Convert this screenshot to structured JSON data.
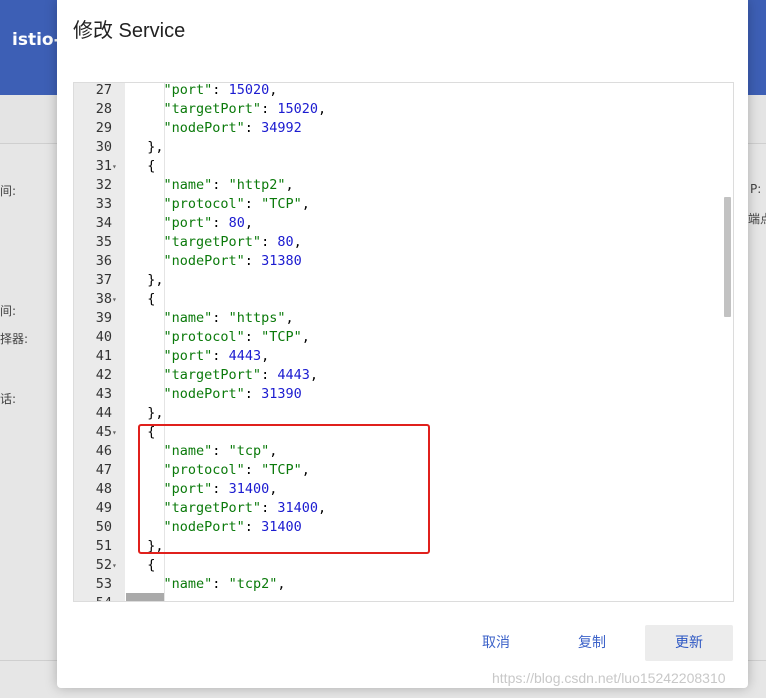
{
  "background": {
    "app_title": "istio-i",
    "labels_left": [
      "间:",
      "间:",
      "择器:",
      "话:"
    ],
    "labels_right": [
      "P:",
      "端点"
    ]
  },
  "dialog": {
    "title": "修改 Service",
    "buttons": {
      "cancel": "取消",
      "copy": "复制",
      "update": "更新"
    }
  },
  "editor": {
    "lines": [
      {
        "num": "27",
        "fold": false,
        "indent": 4,
        "tokens": [
          {
            "t": "k",
            "v": "\"port\""
          },
          {
            "t": "p",
            "v": ": "
          },
          {
            "t": "n",
            "v": "15020"
          },
          {
            "t": "p",
            "v": ","
          }
        ]
      },
      {
        "num": "28",
        "fold": false,
        "indent": 4,
        "tokens": [
          {
            "t": "k",
            "v": "\"targetPort\""
          },
          {
            "t": "p",
            "v": ": "
          },
          {
            "t": "n",
            "v": "15020"
          },
          {
            "t": "p",
            "v": ","
          }
        ]
      },
      {
        "num": "29",
        "fold": false,
        "indent": 4,
        "tokens": [
          {
            "t": "k",
            "v": "\"nodePort\""
          },
          {
            "t": "p",
            "v": ": "
          },
          {
            "t": "n",
            "v": "34992"
          }
        ]
      },
      {
        "num": "30",
        "fold": false,
        "indent": 2,
        "tokens": [
          {
            "t": "p",
            "v": "},"
          }
        ]
      },
      {
        "num": "31",
        "fold": true,
        "indent": 2,
        "tokens": [
          {
            "t": "p",
            "v": "{"
          }
        ]
      },
      {
        "num": "32",
        "fold": false,
        "indent": 4,
        "tokens": [
          {
            "t": "k",
            "v": "\"name\""
          },
          {
            "t": "p",
            "v": ": "
          },
          {
            "t": "s",
            "v": "\"http2\""
          },
          {
            "t": "p",
            "v": ","
          }
        ]
      },
      {
        "num": "33",
        "fold": false,
        "indent": 4,
        "tokens": [
          {
            "t": "k",
            "v": "\"protocol\""
          },
          {
            "t": "p",
            "v": ": "
          },
          {
            "t": "s",
            "v": "\"TCP\""
          },
          {
            "t": "p",
            "v": ","
          }
        ]
      },
      {
        "num": "34",
        "fold": false,
        "indent": 4,
        "tokens": [
          {
            "t": "k",
            "v": "\"port\""
          },
          {
            "t": "p",
            "v": ": "
          },
          {
            "t": "n",
            "v": "80"
          },
          {
            "t": "p",
            "v": ","
          }
        ]
      },
      {
        "num": "35",
        "fold": false,
        "indent": 4,
        "tokens": [
          {
            "t": "k",
            "v": "\"targetPort\""
          },
          {
            "t": "p",
            "v": ": "
          },
          {
            "t": "n",
            "v": "80"
          },
          {
            "t": "p",
            "v": ","
          }
        ]
      },
      {
        "num": "36",
        "fold": false,
        "indent": 4,
        "tokens": [
          {
            "t": "k",
            "v": "\"nodePort\""
          },
          {
            "t": "p",
            "v": ": "
          },
          {
            "t": "n",
            "v": "31380"
          }
        ]
      },
      {
        "num": "37",
        "fold": false,
        "indent": 2,
        "tokens": [
          {
            "t": "p",
            "v": "},"
          }
        ]
      },
      {
        "num": "38",
        "fold": true,
        "indent": 2,
        "tokens": [
          {
            "t": "p",
            "v": "{"
          }
        ]
      },
      {
        "num": "39",
        "fold": false,
        "indent": 4,
        "tokens": [
          {
            "t": "k",
            "v": "\"name\""
          },
          {
            "t": "p",
            "v": ": "
          },
          {
            "t": "s",
            "v": "\"https\""
          },
          {
            "t": "p",
            "v": ","
          }
        ]
      },
      {
        "num": "40",
        "fold": false,
        "indent": 4,
        "tokens": [
          {
            "t": "k",
            "v": "\"protocol\""
          },
          {
            "t": "p",
            "v": ": "
          },
          {
            "t": "s",
            "v": "\"TCP\""
          },
          {
            "t": "p",
            "v": ","
          }
        ]
      },
      {
        "num": "41",
        "fold": false,
        "indent": 4,
        "tokens": [
          {
            "t": "k",
            "v": "\"port\""
          },
          {
            "t": "p",
            "v": ": "
          },
          {
            "t": "n",
            "v": "4443"
          },
          {
            "t": "p",
            "v": ","
          }
        ]
      },
      {
        "num": "42",
        "fold": false,
        "indent": 4,
        "tokens": [
          {
            "t": "k",
            "v": "\"targetPort\""
          },
          {
            "t": "p",
            "v": ": "
          },
          {
            "t": "n",
            "v": "4443"
          },
          {
            "t": "p",
            "v": ","
          }
        ]
      },
      {
        "num": "43",
        "fold": false,
        "indent": 4,
        "tokens": [
          {
            "t": "k",
            "v": "\"nodePort\""
          },
          {
            "t": "p",
            "v": ": "
          },
          {
            "t": "n",
            "v": "31390"
          }
        ]
      },
      {
        "num": "44",
        "fold": false,
        "indent": 2,
        "tokens": [
          {
            "t": "p",
            "v": "},"
          }
        ]
      },
      {
        "num": "45",
        "fold": true,
        "indent": 2,
        "tokens": [
          {
            "t": "p",
            "v": "{"
          }
        ]
      },
      {
        "num": "46",
        "fold": false,
        "indent": 4,
        "tokens": [
          {
            "t": "k",
            "v": "\"name\""
          },
          {
            "t": "p",
            "v": ": "
          },
          {
            "t": "s",
            "v": "\"tcp\""
          },
          {
            "t": "p",
            "v": ","
          }
        ]
      },
      {
        "num": "47",
        "fold": false,
        "indent": 4,
        "tokens": [
          {
            "t": "k",
            "v": "\"protocol\""
          },
          {
            "t": "p",
            "v": ": "
          },
          {
            "t": "s",
            "v": "\"TCP\""
          },
          {
            "t": "p",
            "v": ","
          }
        ]
      },
      {
        "num": "48",
        "fold": false,
        "indent": 4,
        "tokens": [
          {
            "t": "k",
            "v": "\"port\""
          },
          {
            "t": "p",
            "v": ": "
          },
          {
            "t": "n",
            "v": "31400"
          },
          {
            "t": "p",
            "v": ","
          }
        ]
      },
      {
        "num": "49",
        "fold": false,
        "indent": 4,
        "tokens": [
          {
            "t": "k",
            "v": "\"targetPort\""
          },
          {
            "t": "p",
            "v": ": "
          },
          {
            "t": "n",
            "v": "31400"
          },
          {
            "t": "p",
            "v": ","
          }
        ]
      },
      {
        "num": "50",
        "fold": false,
        "indent": 4,
        "tokens": [
          {
            "t": "k",
            "v": "\"nodePort\""
          },
          {
            "t": "p",
            "v": ": "
          },
          {
            "t": "n",
            "v": "31400"
          }
        ]
      },
      {
        "num": "51",
        "fold": false,
        "indent": 2,
        "tokens": [
          {
            "t": "p",
            "v": "},"
          }
        ]
      },
      {
        "num": "52",
        "fold": true,
        "indent": 2,
        "tokens": [
          {
            "t": "p",
            "v": "{"
          }
        ]
      },
      {
        "num": "53",
        "fold": false,
        "indent": 4,
        "tokens": [
          {
            "t": "k",
            "v": "\"name\""
          },
          {
            "t": "p",
            "v": ": "
          },
          {
            "t": "s",
            "v": "\"tcp2\""
          },
          {
            "t": "p",
            "v": ","
          }
        ]
      },
      {
        "num": "54",
        "fold": false,
        "indent": 4,
        "tokens": []
      }
    ]
  },
  "watermark": "https://blog.csdn.net/luo15242208310"
}
